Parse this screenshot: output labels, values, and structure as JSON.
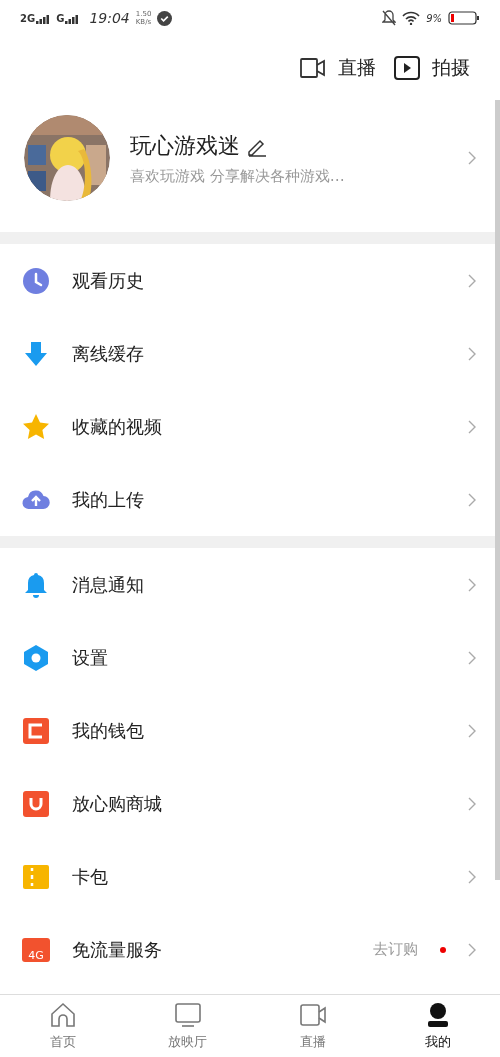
{
  "status_bar": {
    "network_1": "2G",
    "network_2": "G",
    "time": "19:04",
    "speed_value": "1.50",
    "speed_unit": "KB/s",
    "battery": "9%"
  },
  "top_actions": [
    {
      "kind": "camera",
      "label": "直播"
    },
    {
      "kind": "play",
      "label": "拍摄"
    }
  ],
  "profile": {
    "name": "玩心游戏迷",
    "bio": "喜欢玩游戏 分享解决各种游戏…"
  },
  "menu_groups": [
    {
      "items": [
        {
          "kind": "history",
          "label": "观看历史"
        },
        {
          "kind": "download",
          "label": "离线缓存"
        },
        {
          "kind": "star",
          "label": "收藏的视频"
        },
        {
          "kind": "upload",
          "label": "我的上传"
        }
      ]
    },
    {
      "items": [
        {
          "kind": "bell",
          "label": "消息通知"
        },
        {
          "kind": "settings",
          "label": "设置"
        },
        {
          "kind": "wallet",
          "label": "我的钱包"
        },
        {
          "kind": "shop",
          "label": "放心购商城"
        },
        {
          "kind": "card",
          "label": "卡包"
        },
        {
          "kind": "flow",
          "label": "免流量服务",
          "icon_text": "4G",
          "action": "去订购",
          "badge": true
        }
      ]
    }
  ],
  "bottom_nav": [
    {
      "kind": "home",
      "label": "首页",
      "selected": false
    },
    {
      "kind": "tv",
      "label": "放映厅",
      "selected": false
    },
    {
      "kind": "camera",
      "label": "直播",
      "selected": false
    },
    {
      "kind": "avatar",
      "label": "我的",
      "selected": true
    }
  ]
}
